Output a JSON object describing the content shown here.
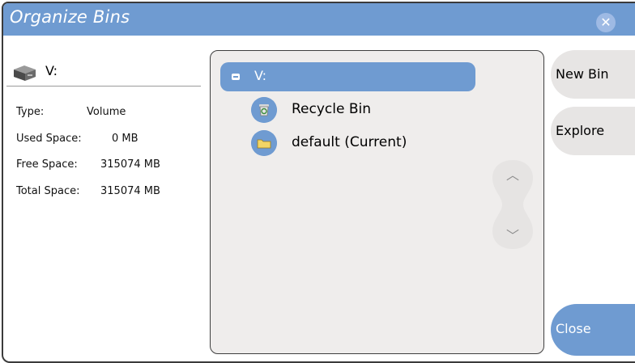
{
  "dialog": {
    "title": "Organize Bins",
    "close_icon": "close-icon",
    "close_glyph": "✕"
  },
  "drive": {
    "icon": "hard-drive-icon",
    "name": "V:",
    "fields": [
      {
        "label": "Type:",
        "value": "Volume"
      },
      {
        "label": "Used Space:",
        "value": "0 MB"
      },
      {
        "label": "Free Space:",
        "value": "315074 MB"
      },
      {
        "label": "Total Space:",
        "value": "315074 MB"
      }
    ]
  },
  "tree": {
    "root": {
      "label": "V:",
      "expand_icon": "collapse-minus-icon"
    },
    "items": [
      {
        "label": "Recycle Bin",
        "icon": "recycle-bin-icon"
      },
      {
        "label": "default (Current)",
        "icon": "folder-icon"
      }
    ],
    "scroll_up_glyph": "︿",
    "scroll_down_glyph": "﹀"
  },
  "buttons": {
    "new_bin": "New Bin",
    "explore": "Explore",
    "close": "Close"
  },
  "colors": {
    "accent": "#6f9bd1",
    "panel_bg": "#efedec",
    "button_bg": "#e7e5e4"
  }
}
